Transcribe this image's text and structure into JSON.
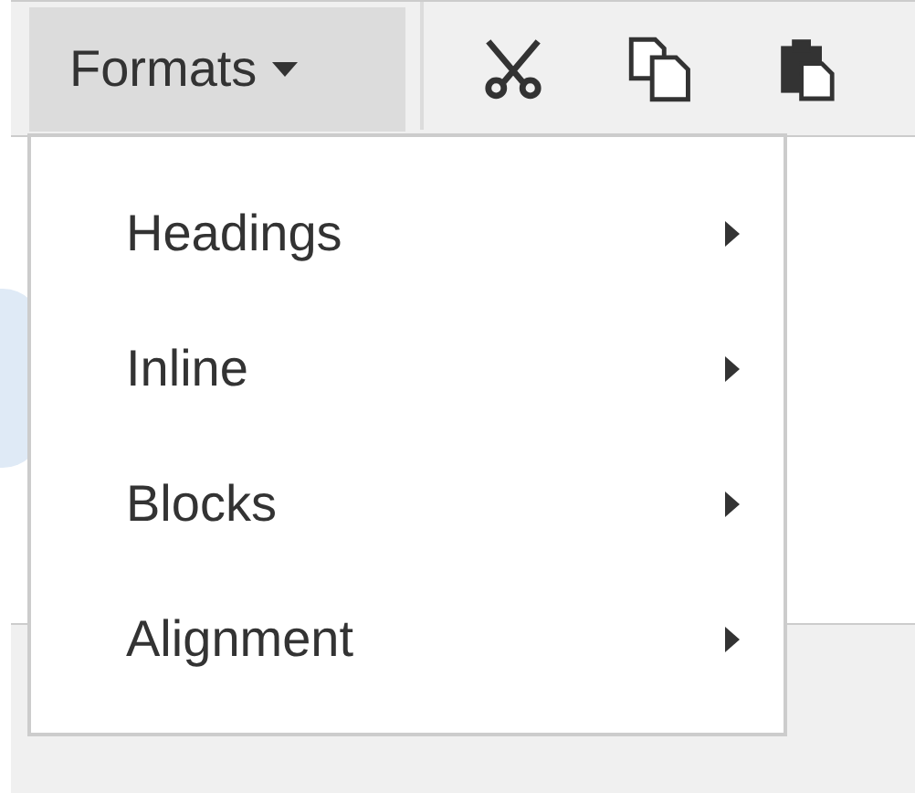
{
  "toolbar": {
    "formats_button": {
      "label": "Formats",
      "expanded": true
    }
  },
  "menu": {
    "items": [
      {
        "label": "Headings",
        "submenu": true
      },
      {
        "label": "Inline",
        "submenu": true
      },
      {
        "label": "Blocks",
        "submenu": true
      },
      {
        "label": "Alignment",
        "submenu": true
      }
    ]
  }
}
